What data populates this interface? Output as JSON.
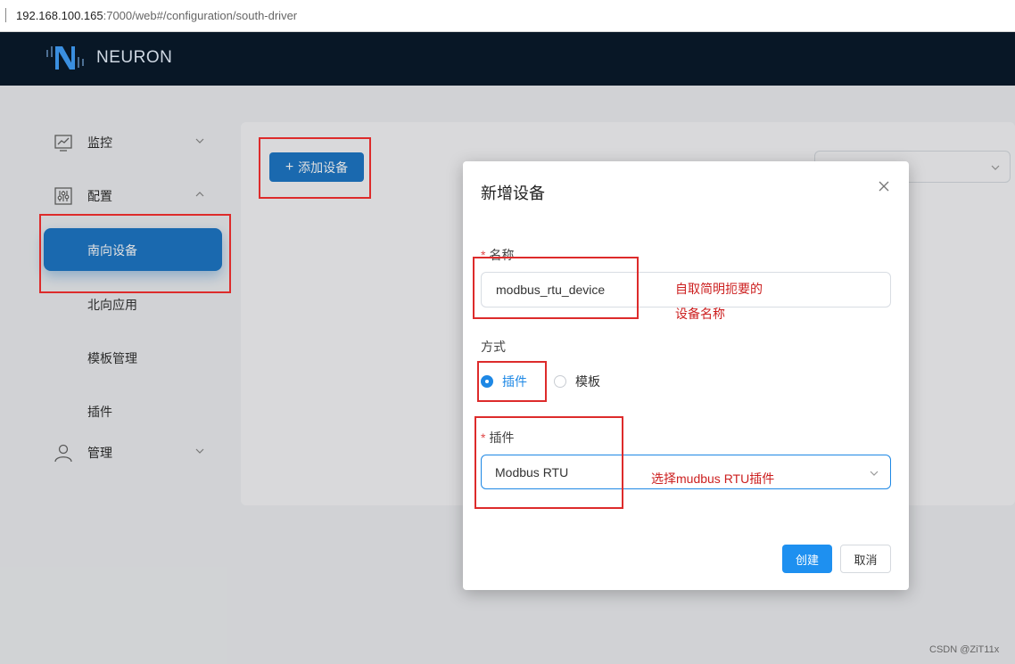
{
  "browser": {
    "url_host": "192.168.100.165",
    "url_rest": ":7000/web#/configuration/south-driver"
  },
  "app": {
    "name": "NEURON"
  },
  "sidebar": {
    "monitor_label": "监控",
    "config_label": "配置",
    "manage_label": "管理",
    "items": [
      {
        "label": "南向设备"
      },
      {
        "label": "北向应用"
      },
      {
        "label": "模板管理"
      },
      {
        "label": "插件"
      }
    ]
  },
  "toolbar": {
    "add_device_label": "添加设备"
  },
  "modal": {
    "title": "新增设备",
    "name_label": "名称",
    "name_value": "modbus_rtu_device",
    "mode_label": "方式",
    "mode_options": [
      {
        "label": "插件",
        "selected": true
      },
      {
        "label": "模板",
        "selected": false
      }
    ],
    "plugin_label": "插件",
    "plugin_value": "Modbus RTU",
    "create_label": "创建",
    "cancel_label": "取消"
  },
  "annotations": {
    "name_note_line1": "自取简明扼要的",
    "name_note_line2": "设备名称",
    "plugin_note": "选择mudbus RTU插件"
  },
  "watermark": "CSDN @ZiT11x",
  "colors": {
    "primary": "#1e78c8",
    "header_bg": "#081726",
    "annotation_red": "#dd2b2b"
  }
}
